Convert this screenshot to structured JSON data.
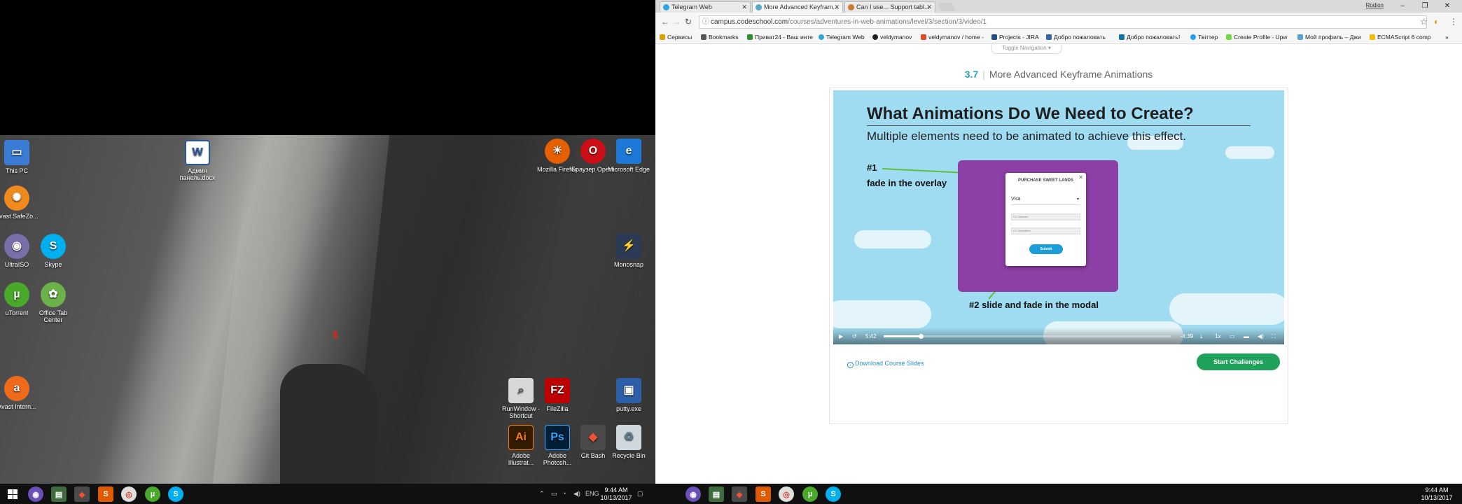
{
  "desktop": {
    "icons": [
      {
        "label": "This PC",
        "icon": "computer-icon",
        "color": "#3a7bd5"
      },
      {
        "label": "Avast SafeZo...",
        "icon": "avast-safezone-icon",
        "color": "#f08a1c"
      },
      {
        "label": "UltraISO",
        "icon": "ultraiso-icon",
        "color": "#7a6fa8"
      },
      {
        "label": "Skype",
        "icon": "skype-icon",
        "color": "#00aff0"
      },
      {
        "label": "uTorrent",
        "icon": "utorrent-icon",
        "color": "#4aa82b"
      },
      {
        "label": "Office Tab Center",
        "icon": "office-tab-icon",
        "color": "#6bb24a"
      },
      {
        "label": "Avast Intern...",
        "icon": "avast-icon",
        "color": "#f06a1c"
      },
      {
        "label": "Админ панель.docx",
        "icon": "word-doc-icon",
        "color": "#2b579a"
      },
      {
        "label": "Mozilla Firefox",
        "icon": "firefox-icon",
        "color": "#e66000"
      },
      {
        "label": "Браузер Opera",
        "icon": "opera-icon",
        "color": "#cc0f16"
      },
      {
        "label": "Microsoft Edge",
        "icon": "edge-icon",
        "color": "#1e78d6"
      },
      {
        "label": "Monosnap",
        "icon": "monosnap-icon",
        "color": "#f5b400"
      },
      {
        "label": "RunWindow - Shortcut",
        "icon": "runwindow-icon",
        "color": "#9a9a9a"
      },
      {
        "label": "FileZilla",
        "icon": "filezilla-icon",
        "color": "#bf0000"
      },
      {
        "label": "putty.exe",
        "icon": "putty-icon",
        "color": "#2d5fa8"
      },
      {
        "label": "Adobe Illustrat...",
        "icon": "illustrator-icon",
        "color": "#ff7c00"
      },
      {
        "label": "Adobe Photosh...",
        "icon": "photoshop-icon",
        "color": "#31a8ff"
      },
      {
        "label": "Git Bash",
        "icon": "git-bash-icon",
        "color": "#c0c0c0"
      },
      {
        "label": "Recycle Bin",
        "icon": "recycle-bin-icon",
        "color": "#cfd8dc"
      }
    ]
  },
  "taskbar_left": {
    "lang": "ENG",
    "time": "9:44 AM",
    "date": "10/13/2017"
  },
  "taskbar_right": {
    "time": "9:44 AM",
    "date": "10/13/2017"
  },
  "browser": {
    "tabs": [
      {
        "label": "Telegram Web",
        "fav_color": "#2ca5e0"
      },
      {
        "label": "More Advanced Keyfram...",
        "fav_color": "#5aa9c8"
      },
      {
        "label": "Can I use... Support tabl...",
        "fav_color": "#c97c2f"
      }
    ],
    "user": "Rodion",
    "url_host": "campus.codeschool.com",
    "url_path": "/courses/adventures-in-web-animations/level/3/section/3/video/1",
    "bookmarks": [
      {
        "label": "Сервисы",
        "color": "#e0a000"
      },
      {
        "label": "Bookmarks",
        "color": "#555555"
      },
      {
        "label": "Приват24 - Ваш инте",
        "color": "#2f8f2f"
      },
      {
        "label": "Telegram Web",
        "color": "#2ca5e0"
      },
      {
        "label": "veldymanov",
        "color": "#222222"
      },
      {
        "label": "veldymanov / home -",
        "color": "#e04a20"
      },
      {
        "label": "Projects - JIRA",
        "color": "#205081"
      },
      {
        "label": "Добро пожаловать",
        "color": "#3465a4"
      },
      {
        "label": "Добро пожаловать!",
        "color": "#0e76a8"
      },
      {
        "label": "Твіттер",
        "color": "#1da1f2"
      },
      {
        "label": "Create Profile - Upw",
        "color": "#6fda44"
      },
      {
        "label": "Мой профиль – Джи",
        "color": "#5aa0d8"
      },
      {
        "label": "ECMAScript 6 comp",
        "color": "#f0c000"
      }
    ]
  },
  "page": {
    "toggle_nav": "Toggle Navigation",
    "lesson_num": "3.7",
    "lesson_title": "More Advanced Keyframe Animations",
    "video": {
      "title": "What Animations Do We Need to Create?",
      "subtitle": "Multiple elements need to be animated to achieve this effect.",
      "ann1_num": "#1",
      "ann1_text": "fade in the overlay",
      "ann2": "#2 slide and fade in the modal",
      "modal_title": "PURCHASE SWEET LANDS",
      "modal_select": "Visa",
      "modal_input1": "CC Number",
      "modal_input2": "CC Expiration",
      "modal_submit": "Submit",
      "time_elapsed": "5:42",
      "time_remaining": "-4:39",
      "speed": "1x",
      "progress": 0.13
    },
    "download_label": "Download Course Slides",
    "start_label": "Start Challenges"
  }
}
